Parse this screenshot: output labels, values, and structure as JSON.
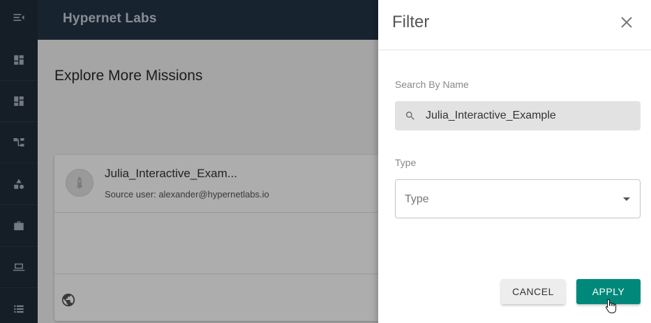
{
  "app": {
    "brand": "Hypernet Labs"
  },
  "sidebar": {
    "items": [
      {
        "icon": "menu-collapse-icon"
      },
      {
        "icon": "dashboard-icon"
      },
      {
        "icon": "dashboard-alt-icon"
      },
      {
        "icon": "workflow-icon"
      },
      {
        "icon": "shapes-icon"
      },
      {
        "icon": "briefcase-icon"
      },
      {
        "icon": "laptop-icon"
      },
      {
        "icon": "list-icon"
      }
    ]
  },
  "main": {
    "title": "Explore More Missions",
    "card": {
      "title": "Julia_Interactive_Exam...",
      "source": "Source user: alexander@hypernetlabs.io",
      "footer_icon": "globe-icon"
    }
  },
  "filter": {
    "title": "Filter",
    "search_label": "Search By Name",
    "search_value": "Julia_Interactive_Example",
    "type_label": "Type",
    "type_placeholder": "Type",
    "cancel_label": "CANCEL",
    "apply_label": "APPLY"
  },
  "colors": {
    "rail": "#1f2b3a",
    "topbar": "#243447",
    "apply": "#00897b"
  }
}
